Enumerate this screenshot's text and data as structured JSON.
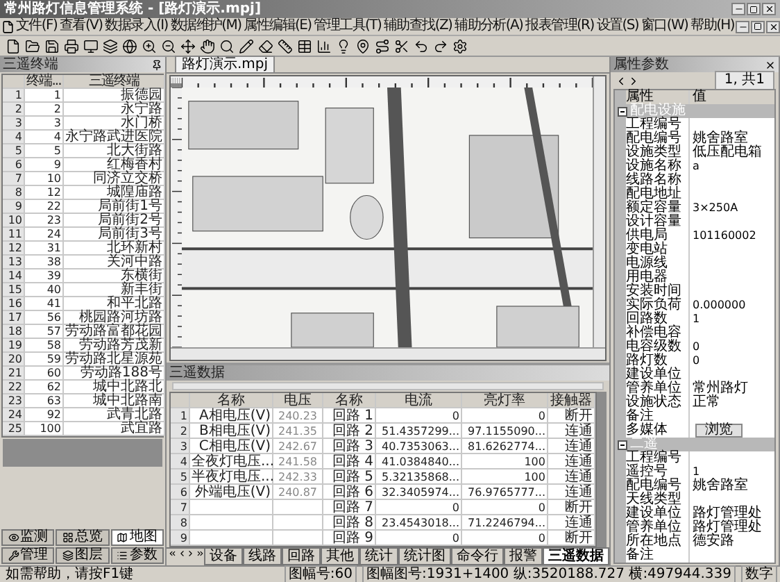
{
  "window": {
    "title": "常州路灯信息管理系统 - [路灯演示.mpj]"
  },
  "menu": [
    "文件(F)",
    "查看(V)",
    "数据录入(I)",
    "数据维护(M)",
    "属性编辑(E)",
    "管理工具(T)",
    "辅助查找(Z)",
    "辅助分析(A)",
    "报表管理(R)",
    "设置(S)",
    "窗口(W)",
    "帮助(H)"
  ],
  "terminals": {
    "title": "三遥终端",
    "columns": [
      "终端...",
      "三遥终端"
    ],
    "rows": [
      {
        "index": "1",
        "terminal": "1",
        "name": "振德园"
      },
      {
        "index": "2",
        "terminal": "2",
        "name": "永宁路"
      },
      {
        "index": "3",
        "terminal": "3",
        "name": "水门桥"
      },
      {
        "index": "4",
        "terminal": "4",
        "name": "永宁路武进医院"
      },
      {
        "index": "5",
        "terminal": "5",
        "name": "北大街路"
      },
      {
        "index": "6",
        "terminal": "9",
        "name": "红梅香村"
      },
      {
        "index": "7",
        "terminal": "10",
        "name": "同济立交桥"
      },
      {
        "index": "8",
        "terminal": "12",
        "name": "城隍庙路"
      },
      {
        "index": "9",
        "terminal": "22",
        "name": "局前街1号"
      },
      {
        "index": "10",
        "terminal": "23",
        "name": "局前街2号"
      },
      {
        "index": "11",
        "terminal": "24",
        "name": "局前街3号"
      },
      {
        "index": "12",
        "terminal": "31",
        "name": "北环新村"
      },
      {
        "index": "13",
        "terminal": "38",
        "name": "关河中路"
      },
      {
        "index": "14",
        "terminal": "39",
        "name": "东横街"
      },
      {
        "index": "15",
        "terminal": "40",
        "name": "新丰街"
      },
      {
        "index": "16",
        "terminal": "41",
        "name": "和平北路"
      },
      {
        "index": "17",
        "terminal": "56",
        "name": "桃园路河坊路"
      },
      {
        "index": "18",
        "terminal": "57",
        "name": "劳动路富都花园"
      },
      {
        "index": "19",
        "terminal": "58",
        "name": "劳动路芳茂新"
      },
      {
        "index": "20",
        "terminal": "59",
        "name": "劳动路北星源苑"
      },
      {
        "index": "21",
        "terminal": "60",
        "name": "劳动路188号"
      },
      {
        "index": "22",
        "terminal": "62",
        "name": "城中北路北"
      },
      {
        "index": "23",
        "terminal": "63",
        "name": "城中北路南"
      },
      {
        "index": "24",
        "terminal": "92",
        "name": "武青北路"
      },
      {
        "index": "25",
        "terminal": "100",
        "name": "武宜路"
      }
    ],
    "tabs": [
      {
        "label": "监测",
        "selected": false
      },
      {
        "label": "总览",
        "selected": false
      },
      {
        "label": "地图",
        "selected": true
      },
      {
        "label": "管理",
        "selected": false
      },
      {
        "label": "图层",
        "selected": false
      },
      {
        "label": "参数",
        "selected": false
      }
    ]
  },
  "map": {
    "tab": "路灯演示.mpj"
  },
  "data_panel": {
    "title": "三遥数据",
    "columns": [
      "名称",
      "电压",
      "名称",
      "电流",
      "亮灯率",
      "接触器"
    ],
    "rows": [
      {
        "index": "1",
        "voltage_name": "A相电压(V)",
        "voltage": "240.23",
        "loop": "回路 1",
        "current": "0",
        "rate": "0",
        "contactor": "断开"
      },
      {
        "index": "2",
        "voltage_name": "B相电压(V)",
        "voltage": "241.35",
        "loop": "回路 2",
        "current": "51.4357299...",
        "rate": "97.1155090...",
        "contactor": "连通"
      },
      {
        "index": "3",
        "voltage_name": "C相电压(V)",
        "voltage": "242.67",
        "loop": "回路 3",
        "current": "40.7353063...",
        "rate": "81.6262774...",
        "contactor": "连通"
      },
      {
        "index": "4",
        "voltage_name": "全夜灯电压...",
        "voltage": "241.58",
        "loop": "回路 4",
        "current": "41.0384840...",
        "rate": "100",
        "contactor": "连通"
      },
      {
        "index": "5",
        "voltage_name": "半夜灯电压...",
        "voltage": "242.33",
        "loop": "回路 5",
        "current": "5.32135868...",
        "rate": "100",
        "contactor": "连通"
      },
      {
        "index": "6",
        "voltage_name": "外端电压(V)",
        "voltage": "240.87",
        "loop": "回路 6",
        "current": "32.3405974...",
        "rate": "76.9765777...",
        "contactor": "连通"
      },
      {
        "index": "7",
        "loop": "回路 7",
        "current": "0",
        "rate": "0",
        "contactor": "断开"
      },
      {
        "index": "8",
        "loop": "回路 8",
        "current": "23.4543018...",
        "rate": "71.2246794...",
        "contactor": "连通"
      },
      {
        "index": "9",
        "loop": "回路 9",
        "current": "0",
        "rate": "0",
        "contactor": "断开"
      }
    ],
    "sheet_tabs": [
      {
        "label": "设备",
        "selected": false
      },
      {
        "label": "线路",
        "selected": false
      },
      {
        "label": "回路",
        "selected": false
      },
      {
        "label": "其他",
        "selected": false
      },
      {
        "label": "统计",
        "selected": false
      },
      {
        "label": "统计图",
        "selected": false
      },
      {
        "label": "命令行",
        "selected": false
      },
      {
        "label": "报警",
        "selected": false
      },
      {
        "label": "三遥数据",
        "selected": true
      }
    ]
  },
  "properties": {
    "title": "属性参数",
    "record": "1, 共1",
    "columns": [
      "属性",
      "值"
    ],
    "groups": [
      {
        "title": "配电设施",
        "expanded": true,
        "rows": [
          {
            "kind": "text",
            "label": "工程编号"
          },
          {
            "kind": "text",
            "label": "配电编号",
            "value": "姚舍路室"
          },
          {
            "kind": "text",
            "label": "设施类型",
            "value": "低压配电箱"
          },
          {
            "kind": "text",
            "label": "设施名称",
            "value": "a"
          },
          {
            "kind": "text",
            "label": "线路名称"
          },
          {
            "kind": "text",
            "label": "配电地址"
          },
          {
            "kind": "text",
            "label": "额定容量",
            "value": "3×250A"
          },
          {
            "kind": "text",
            "label": "设计容量"
          },
          {
            "kind": "text",
            "label": "供电局",
            "value": "101160002"
          },
          {
            "kind": "text",
            "label": "变电站"
          },
          {
            "kind": "text",
            "label": "电源线"
          },
          {
            "kind": "text",
            "label": "用电器"
          },
          {
            "kind": "text",
            "label": "安装时间"
          },
          {
            "kind": "text",
            "label": "实际负荷",
            "value": "0.000000"
          },
          {
            "kind": "text",
            "label": "回路数",
            "value": "1"
          },
          {
            "kind": "text",
            "label": "补偿电容"
          },
          {
            "kind": "text",
            "label": "电容级数",
            "value": "0"
          },
          {
            "kind": "text",
            "label": "路灯数",
            "value": "0"
          },
          {
            "kind": "text",
            "label": "建设单位"
          },
          {
            "kind": "text",
            "label": "管养单位",
            "value": "常州路灯"
          },
          {
            "kind": "text",
            "label": "设施状态",
            "value": "正常"
          },
          {
            "kind": "text",
            "label": "备注"
          },
          {
            "kind": "button",
            "label": "多媒体",
            "value": "浏览"
          }
        ]
      },
      {
        "title": "二遥",
        "expanded": true,
        "rows": [
          {
            "kind": "text",
            "label": "工程编号"
          },
          {
            "kind": "text",
            "label": "遥控号",
            "value": "1"
          },
          {
            "kind": "text",
            "label": "配电编号",
            "value": "姚舍路室"
          },
          {
            "kind": "text",
            "label": "天线类型"
          },
          {
            "kind": "text",
            "label": "建设单位",
            "value": "路灯管理处"
          },
          {
            "kind": "text",
            "label": "管养单位",
            "value": "路灯管理处"
          },
          {
            "kind": "text",
            "label": "所在地点",
            "value": "德安路"
          },
          {
            "kind": "text",
            "label": "备注"
          }
        ]
      }
    ]
  },
  "status_bar": {
    "help": "如需帮助，请按F1键",
    "sheet": "图幅号:60",
    "coords": "图幅图号:1931+1400 纵:3520188.727 横:497944.339",
    "mode": "数字"
  }
}
